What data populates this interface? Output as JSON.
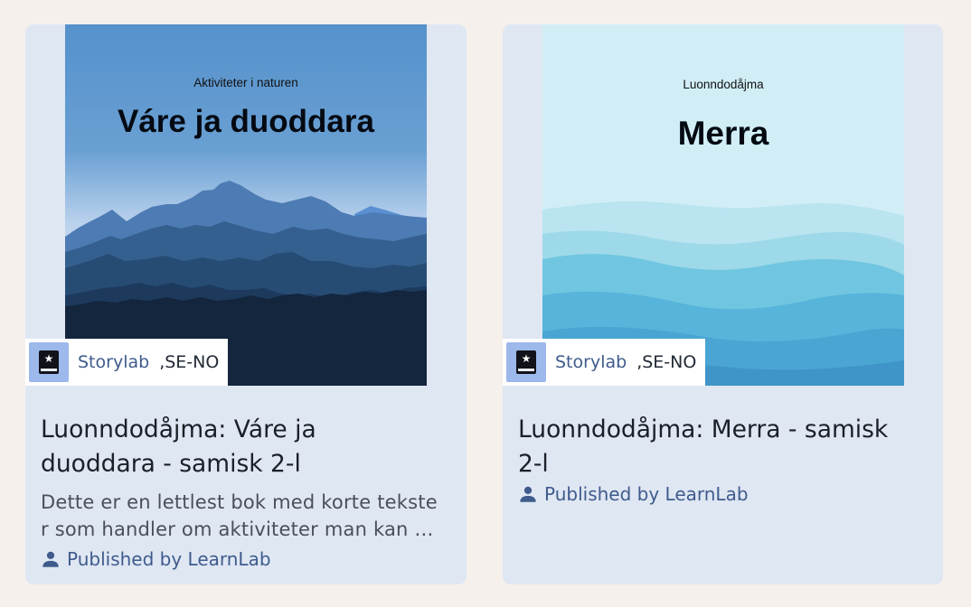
{
  "cards": [
    {
      "cover": {
        "subtitle": "Aktiviteter i naturen",
        "title": "Váre ja duoddara"
      },
      "source": {
        "name": "Storylab",
        "locale": ",SE-NO",
        "icon": "storylab-book-icon"
      },
      "title_line1": "Luonndodåjma: Váre ja",
      "title_line2": "duoddara - samisk 2-l",
      "description_line1": "Dette er en lettlest bok med korte tekste",
      "description_line2": "r som handler om aktiviteter man kan …",
      "publisher": "Published by LearnLab"
    },
    {
      "cover": {
        "subtitle": "Luonndodåjma",
        "title": "Merra"
      },
      "source": {
        "name": "Storylab",
        "locale": ",SE-NO",
        "icon": "storylab-book-icon"
      },
      "title_line1": "Luonndodåjma: Merra - samisk",
      "title_line2": "2-l",
      "publisher": "Published by LearnLab"
    }
  ],
  "colors": {
    "page_bg": "#f5f0ec",
    "card_bg": "#dfe7f3",
    "link": "#3f5b8c",
    "source_icon_bg": "#9db8ea"
  }
}
